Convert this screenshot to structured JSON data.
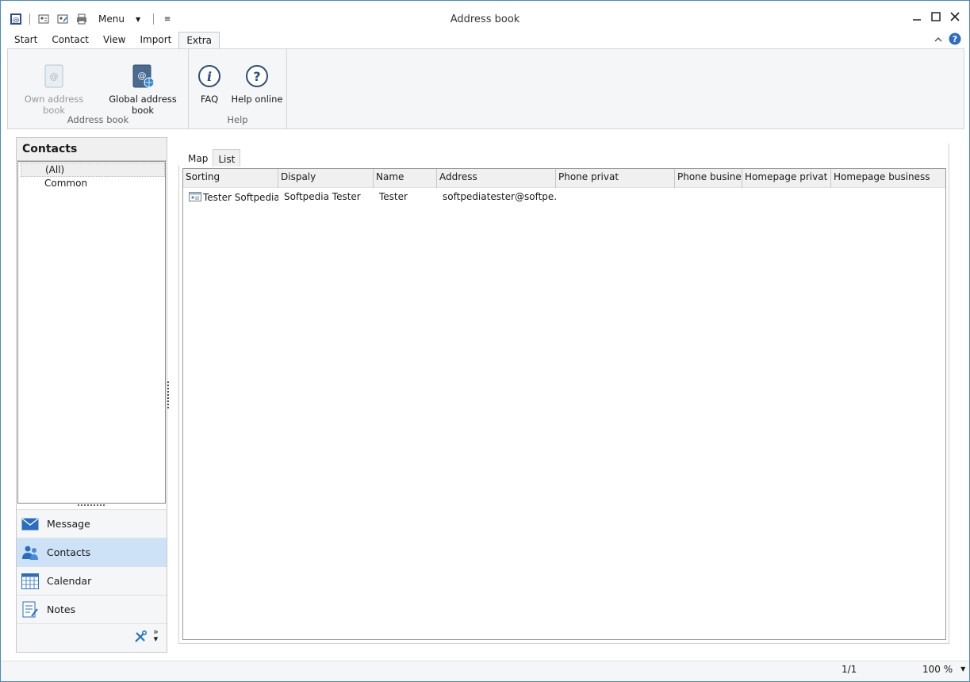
{
  "window": {
    "title": "Address book"
  },
  "qat": {
    "menu_label": "Menu"
  },
  "ribbon": {
    "tabs": [
      "Start",
      "Contact",
      "View",
      "Import",
      "Extra"
    ],
    "groups": [
      {
        "label": "Address book",
        "buttons": [
          "Own address book",
          "Global address book"
        ]
      },
      {
        "label": "Help",
        "buttons": [
          "FAQ",
          "Help online"
        ]
      }
    ]
  },
  "nav": {
    "title": "Contacts",
    "tree": [
      "(All)",
      "Common"
    ],
    "buttons": [
      "Message",
      "Contacts",
      "Calendar",
      "Notes"
    ]
  },
  "view": {
    "tabs": [
      "Map",
      "List"
    ],
    "columns": [
      "Sorting",
      "Dispaly",
      "Name",
      "Address",
      "Phone privat",
      "Phone business",
      "Homepage privat",
      "Homepage business"
    ],
    "rows": [
      {
        "sorting": "Tester Softpedia",
        "display": "Softpedia Tester",
        "name": "Tester",
        "address": "softpediatester@softpe..."
      }
    ]
  },
  "status": {
    "page": "1/1",
    "zoom": "100 %"
  },
  "colors": {
    "accent": "#1e73c8",
    "selected_nav": "#cde2f7",
    "window_border": "#4a86c8"
  }
}
